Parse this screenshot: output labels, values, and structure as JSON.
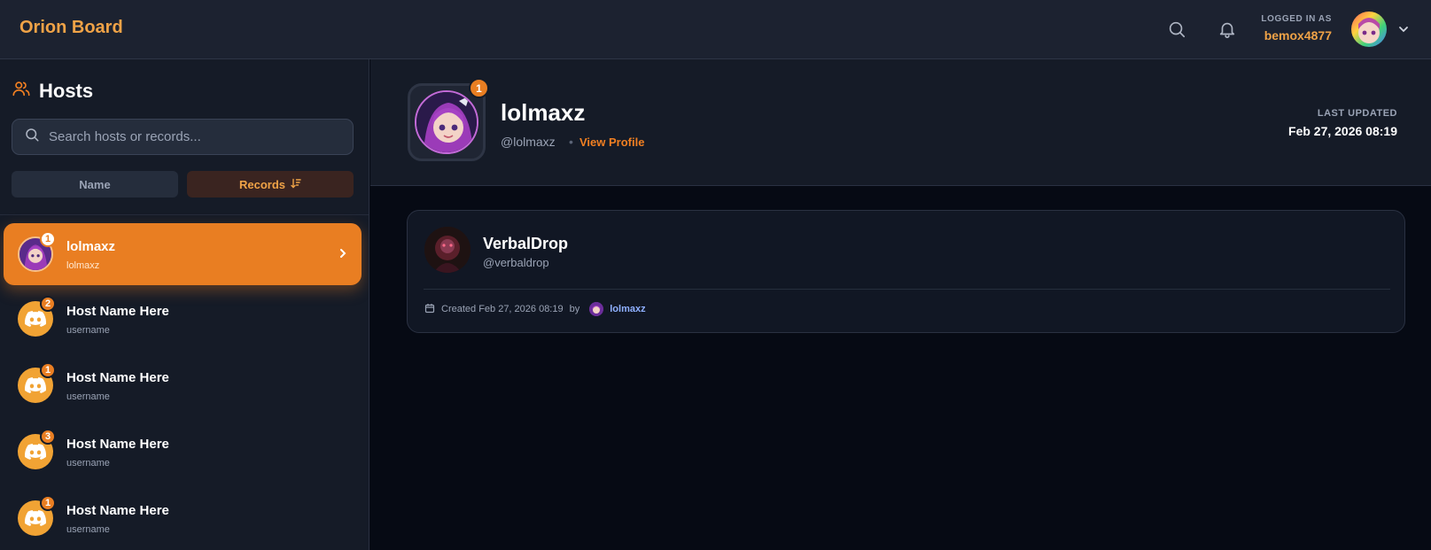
{
  "app": {
    "title": "Orion Board"
  },
  "header": {
    "logged_in_label": "LOGGED IN AS",
    "username": "bemox4877",
    "accent": "#f0a347"
  },
  "sidebar": {
    "title": "Hosts",
    "search_placeholder": "Search hosts or records...",
    "sort": {
      "name_label": "Name",
      "records_label": "Records",
      "active": "Records"
    },
    "hosts": [
      {
        "name": "lolmaxz",
        "username": "lolmaxz",
        "count": "1",
        "active": true,
        "avatar": "anime-avatar"
      },
      {
        "name": "Host Name Here",
        "username": "username",
        "count": "2",
        "active": false,
        "avatar": "discord-icon"
      },
      {
        "name": "Host Name Here",
        "username": "username",
        "count": "1",
        "active": false,
        "avatar": "discord-icon"
      },
      {
        "name": "Host Name Here",
        "username": "username",
        "count": "3",
        "active": false,
        "avatar": "discord-icon"
      },
      {
        "name": "Host Name Here",
        "username": "username",
        "count": "1",
        "active": false,
        "avatar": "discord-icon"
      }
    ]
  },
  "profile": {
    "name": "lolmaxz",
    "handle": "@lolmaxz",
    "separator": "•",
    "view_profile": "View Profile",
    "badge": "1",
    "last_updated_label": "LAST UPDATED",
    "last_updated_value": "Feb 27, 2026 08:19"
  },
  "records": [
    {
      "name": "VerbalDrop",
      "handle": "@verbaldrop",
      "created_text": "Created Feb 27, 2026 08:19",
      "by_label": "by",
      "by_user": "lolmaxz"
    }
  ],
  "colors": {
    "orange": "#e97e22",
    "bg": "#060a14",
    "panel": "#151b27",
    "link_blue": "#8fb0ff"
  }
}
